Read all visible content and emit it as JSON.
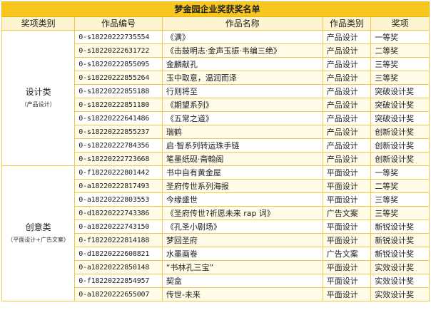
{
  "title": "梦金园企业奖获奖名单",
  "headers": [
    "奖项类别",
    "作品编号",
    "作品名称",
    "作品类别",
    "奖项"
  ],
  "groups": [
    {
      "category": "设计类",
      "sub": "（产品设计）",
      "rows": [
        [
          "0-s18220222735554",
          "《满》",
          "产品设计",
          "一等奖"
        ],
        [
          "0-s18220222631722",
          "《击鼓明志·金声玉振·韦编三绝》",
          "产品设计",
          "二等奖"
        ],
        [
          "0-s18220222855095",
          "金麟献孔",
          "产品设计",
          "三等奖"
        ],
        [
          "0-s18220222855264",
          "玉中取意，温润而泽",
          "产品设计",
          "三等奖"
        ],
        [
          "0-s18220222855188",
          "行则将至",
          "产品设计",
          "突破设计奖"
        ],
        [
          "0-s18220222851180",
          "《期望系列》",
          "产品设计",
          "突破设计奖"
        ],
        [
          "0-s18220222641486",
          "《五常之道》",
          "产品设计",
          "突破设计奖"
        ],
        [
          "0-s18220222855237",
          "瑞鹤",
          "产品设计",
          "创新设计奖"
        ],
        [
          "0-s18220222784356",
          "启·智系列转运珠手链",
          "产品设计",
          "创新设计奖"
        ],
        [
          "0-s18220222723668",
          "笔墨纸砚·斋翰阁",
          "产品设计",
          "创新设计奖"
        ]
      ]
    },
    {
      "category": "创意类",
      "sub": "（平面设计+广告文案）",
      "rows": [
        [
          "0-f18220222801442",
          "书中自有黄金屋",
          "平面设计",
          "一等奖"
        ],
        [
          "0-a18220222817493",
          "圣府传世系列海报",
          "平面设计",
          "二等奖"
        ],
        [
          "0-a18220222803553",
          "今缘盛世",
          "平面设计",
          "三等奖"
        ],
        [
          "0-d18220222743386",
          "《圣府传世?祈愿未来 rap 词》",
          "广告文案",
          "三等奖"
        ],
        [
          "0-a18220222743150",
          "《孔圣小剧场》",
          "平面设计",
          "新锐设计奖"
        ],
        [
          "0-f18220222814188",
          "梦回圣府",
          "平面设计",
          "新锐设计奖"
        ],
        [
          "0-d18220222608821",
          "水墨画卷",
          "广告文案",
          "新锐设计奖"
        ],
        [
          "0-a18220222850148",
          "“书林孔三宝”",
          "平面设计",
          "实效设计奖"
        ],
        [
          "0-f18220222854957",
          "契盒",
          "平面设计",
          "实效设计奖"
        ],
        [
          "0-a18220222655007",
          "传世-未来",
          "平面设计",
          "实效设计奖"
        ]
      ]
    }
  ],
  "colors": {
    "title_bg": "#f7c61f",
    "header_bg": "#fdf5cf",
    "border": "#f0c94c"
  }
}
